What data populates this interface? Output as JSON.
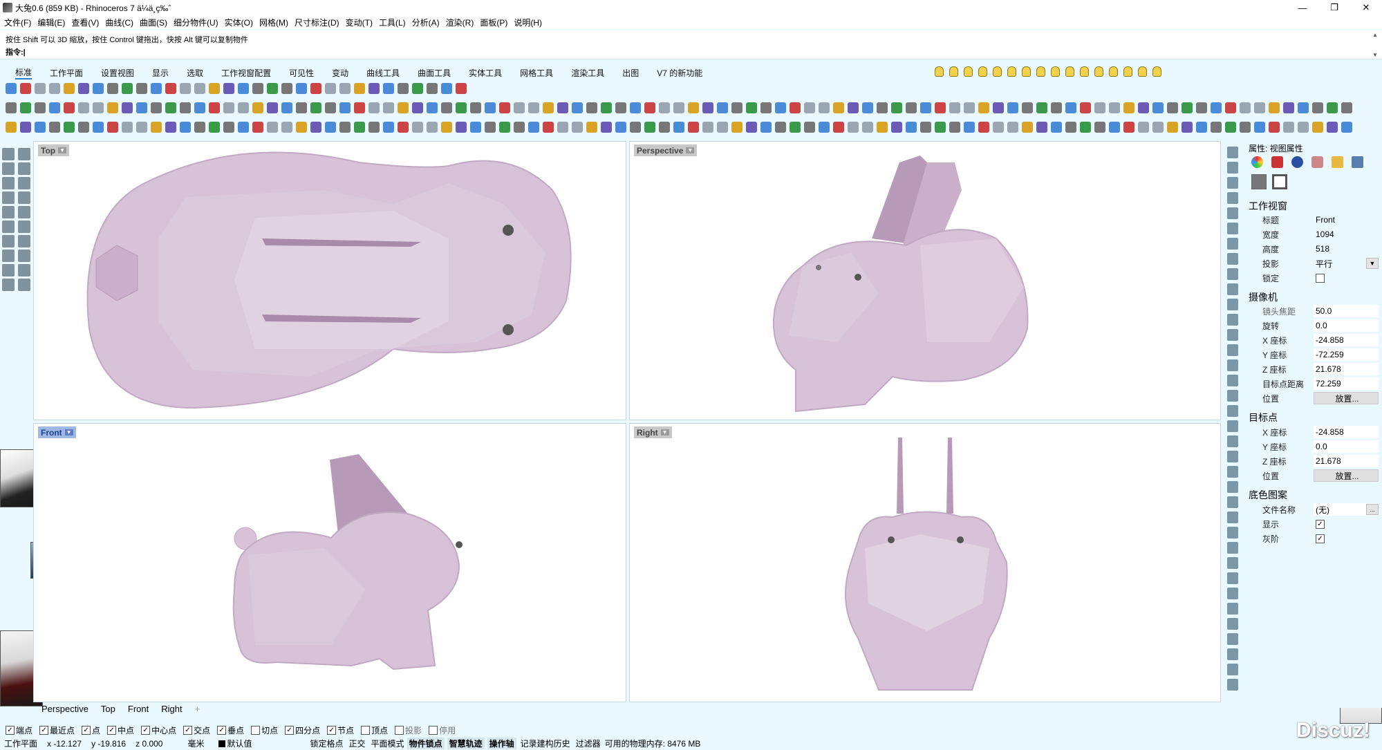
{
  "window": {
    "title": "大兔0.6 (859 KB) - Rhinoceros 7 ä¼ä¸ç‰ˆ",
    "controls": [
      "—",
      "❐",
      "✕"
    ]
  },
  "menu": [
    "文件(F)",
    "编辑(E)",
    "查看(V)",
    "曲线(C)",
    "曲面(S)",
    "细分物件(U)",
    "实体(O)",
    "网格(M)",
    "尺寸标注(D)",
    "变动(T)",
    "工具(L)",
    "分析(A)",
    "渲染(R)",
    "面板(P)",
    "说明(H)"
  ],
  "command": {
    "history": "按住 Shift 可以 3D 缩放，按住 Control 键拖出，快按 Alt 键可以复制物件",
    "prompt": "指令:",
    "value": ""
  },
  "toolbar_tabs": [
    "标准",
    "工作平面",
    "设置视图",
    "显示",
    "选取",
    "工作视窗配置",
    "可见性",
    "变动",
    "曲线工具",
    "曲面工具",
    "实体工具",
    "网格工具",
    "渲染工具",
    "出图",
    "V7 的新功能"
  ],
  "viewports": {
    "top": {
      "label": "Top"
    },
    "perspective": {
      "label": "Perspective"
    },
    "front": {
      "label": "Front"
    },
    "right": {
      "label": "Right"
    }
  },
  "viewport_tabs": [
    "Perspective",
    "Top",
    "Front",
    "Right",
    "+"
  ],
  "properties": {
    "header": "属性: 视图属性",
    "viewport_section": "工作视窗",
    "viewport_rows": [
      {
        "k": "标题",
        "v": "Front"
      },
      {
        "k": "宽度",
        "v": "1094"
      },
      {
        "k": "高度",
        "v": "518"
      },
      {
        "k": "投影",
        "v": "平行"
      },
      {
        "k": "锁定",
        "v": ""
      }
    ],
    "camera_section": "摄像机",
    "camera_rows": [
      {
        "k": "镜头焦距",
        "v": "50.0"
      },
      {
        "k": "旋转",
        "v": "0.0"
      },
      {
        "k": "X 座标",
        "v": "-24.858"
      },
      {
        "k": "Y 座标",
        "v": "-72.259"
      },
      {
        "k": "Z 座标",
        "v": "21.678"
      },
      {
        "k": "目标点距离",
        "v": "72.259"
      },
      {
        "k": "位置",
        "v": "放置..."
      }
    ],
    "target_section": "目标点",
    "target_rows": [
      {
        "k": "X 座标",
        "v": "-24.858"
      },
      {
        "k": "Y 座标",
        "v": "0.0"
      },
      {
        "k": "Z 座标",
        "v": "21.678"
      },
      {
        "k": "位置",
        "v": "放置..."
      }
    ],
    "bg_section": "底色图案",
    "bg_rows": [
      {
        "k": "文件名称",
        "v": "(无)"
      },
      {
        "k": "显示",
        "v": "✓"
      },
      {
        "k": "灰阶",
        "v": "✓"
      }
    ]
  },
  "osnap": [
    {
      "label": "端点",
      "checked": true
    },
    {
      "label": "最近点",
      "checked": true
    },
    {
      "label": "点",
      "checked": true
    },
    {
      "label": "中点",
      "checked": true
    },
    {
      "label": "中心点",
      "checked": true
    },
    {
      "label": "交点",
      "checked": true
    },
    {
      "label": "垂点",
      "checked": true
    },
    {
      "label": "切点",
      "checked": false
    },
    {
      "label": "四分点",
      "checked": true
    },
    {
      "label": "节点",
      "checked": true
    },
    {
      "label": "顶点",
      "checked": false
    },
    {
      "label": "投影",
      "checked": false
    },
    {
      "label": "停用",
      "checked": false
    }
  ],
  "status": {
    "cplane": "工作平面",
    "x": "x -12.127",
    "y": "y -19.816",
    "z": "z 0.000",
    "unit": "毫米",
    "layer": "默认值",
    "items": [
      "锁定格点",
      "正交",
      "平面模式",
      "物件锁点",
      "智慧轨迹",
      "操作轴",
      "记录建构历史",
      "过滤器"
    ],
    "memory": "可用的物理内存: 8476 MB"
  },
  "watermark": "Discuz!",
  "colors": {
    "bunny": "#d7c2d8",
    "bunny_dark": "#b79ab8",
    "panel_bg": "#eaf9ff",
    "active_label": "#9fb8e6"
  }
}
